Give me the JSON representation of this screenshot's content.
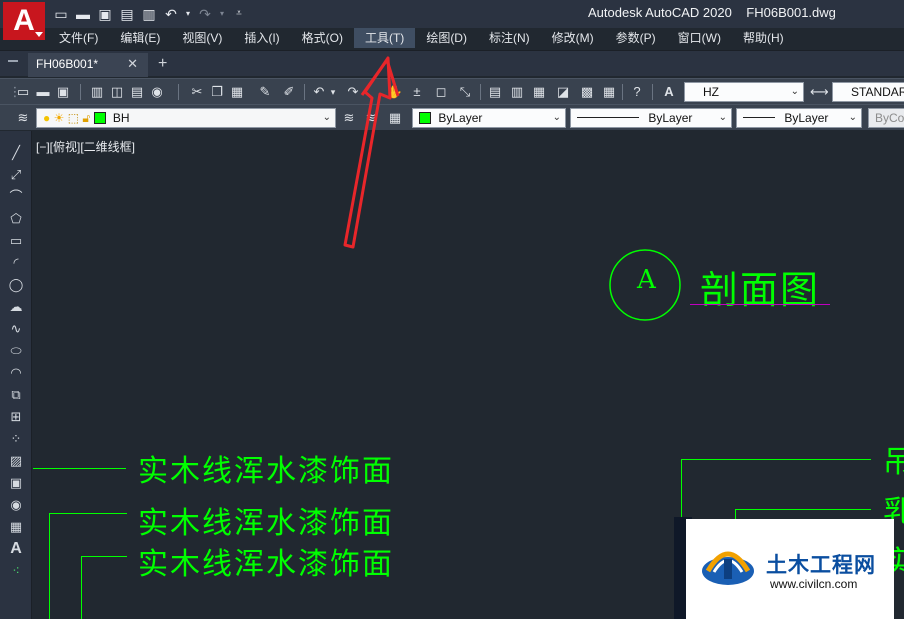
{
  "window": {
    "app_title": "Autodesk AutoCAD 2020",
    "file_title": "FH06B001.dwg",
    "logo_letter": "A"
  },
  "menu": {
    "items": [
      {
        "label": "文件(F)"
      },
      {
        "label": "编辑(E)"
      },
      {
        "label": "视图(V)"
      },
      {
        "label": "插入(I)"
      },
      {
        "label": "格式(O)"
      },
      {
        "label": "工具(T)"
      },
      {
        "label": "绘图(D)"
      },
      {
        "label": "标注(N)"
      },
      {
        "label": "修改(M)"
      },
      {
        "label": "参数(P)"
      },
      {
        "label": "窗口(W)"
      },
      {
        "label": "帮助(H)"
      }
    ],
    "active_item": "工具(T)"
  },
  "tabs": {
    "document_tab": "FH06B001*",
    "close_glyph": "✕",
    "add_glyph": "+"
  },
  "toolbar": {
    "text_style": "HZ",
    "dim_style": "STANDARD",
    "layer_name": "BH",
    "color": "ByLayer",
    "linetype": "ByLayer",
    "lineweight": "ByLayer",
    "plotstyle": "ByCo"
  },
  "canvas": {
    "view_label": "[−][俯视][二维线框]",
    "section_bubble": "A",
    "section_title": "剖面图",
    "notes": [
      {
        "text": "实木线浑水漆饰面"
      },
      {
        "text": "实木线浑水漆饰面"
      },
      {
        "text": "实木线浑水漆饰面"
      }
    ],
    "right_partial_texts": [
      "吊",
      "乳",
      "实"
    ]
  },
  "watermark": {
    "title": "土木工程网",
    "url": "www.civilcn.com"
  },
  "colors": {
    "cad_green": "#00ff00",
    "underline_magenta": "#c000c0",
    "arrow_red": "#e8262a",
    "active_menu": "#3f4e62"
  }
}
